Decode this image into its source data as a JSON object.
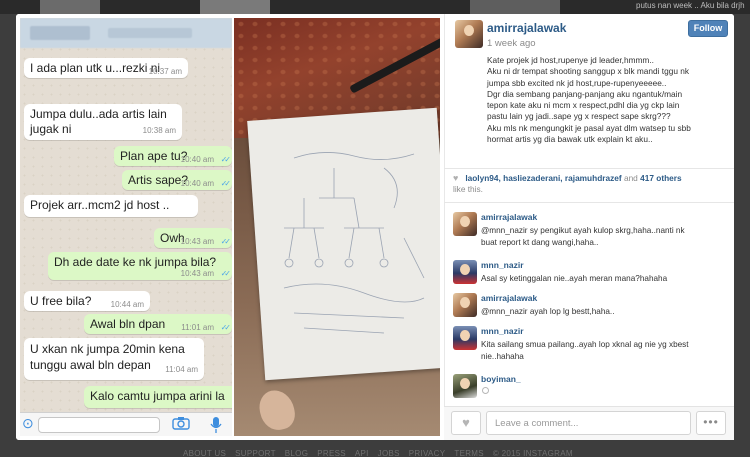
{
  "backdrop": {
    "top_text": "putus nan week .. Aku bila drjh"
  },
  "footer": {
    "links": [
      "ABOUT US",
      "SUPPORT",
      "BLOG",
      "PRESS",
      "API",
      "JOBS",
      "PRIVACY",
      "TERMS"
    ],
    "copyright": "© 2015 INSTAGRAM"
  },
  "post": {
    "owner": "amirrajalawak",
    "time": "1 week ago",
    "follow_label": "Follow",
    "caption_lines": [
      "Kate projek jd host,rupenye jd leader,hmmm..",
      "Aku ni dr tempat shooting sanggup x blk mandi tggu nk",
      "jumpa sbb excited nk jd host,rupe-rupenyeeeee..",
      "Dgr dia sembang panjang-panjang aku ngantuk/main",
      "tepon kate aku ni mcm x respect,pdhl dia yg ckp lain",
      "pastu lain yg jadi..sape yg x respect sape skrg???",
      "Aku mls nk mengungkit je pasal ayat dlm watsep tu sbb",
      "hormat artis yg dia bawak utk explain kt aku.."
    ],
    "likes": {
      "users": "laolyn94, hasliezaderani, rajamuhdrazef",
      "and": "and",
      "count": "417 others",
      "suffix": "like this."
    }
  },
  "comments": [
    {
      "user": "amirrajalawak",
      "lines": [
        "@mnn_nazir sy pengikut ayah kulop skrg,haha..nanti nk",
        "buat report kt dang wangi,haha.."
      ]
    },
    {
      "user": "mnn_nazir",
      "lines": [
        "Asal sy ketinggalan nie..ayah meran mana?hahaha"
      ]
    },
    {
      "user": "amirrajalawak",
      "lines": [
        "@mnn_nazir ayah lop lg bestt,haha.."
      ]
    },
    {
      "user": "mnn_nazir",
      "lines": [
        "Kita sailang smua pailang..ayah lop xknal ag nie yg xbest",
        "nie..hahaha"
      ]
    },
    {
      "user": "boyiman_",
      "lines": []
    }
  ],
  "comment_box": {
    "placeholder": "Leave a comment...",
    "more_label": "•••"
  },
  "chat": {
    "messages": [
      {
        "text": "I ada plan utk u...rezki ni",
        "time": "10:37 am",
        "dir": "in"
      },
      {
        "text": "Jumpa dulu..ada artis lain",
        "text2": "jugak ni",
        "time": "10:38 am",
        "dir": "in"
      },
      {
        "text": "Plan ape tu?",
        "time": "10:40 am",
        "dir": "out"
      },
      {
        "text": "Artis sape?",
        "time": "10:40 am",
        "dir": "out"
      },
      {
        "text": "Projek arr..mcm2 jd host ..",
        "time": "",
        "dir": "in"
      },
      {
        "text": "Owh",
        "time": "10:43 am",
        "dir": "out"
      },
      {
        "text": "Dh ade date ke nk jumpa bila?",
        "time": "10:43 am",
        "dir": "out"
      },
      {
        "text": "U free bila?",
        "time": "10:44 am",
        "dir": "in"
      },
      {
        "text": "Awal bln dpan",
        "time": "11:01 am",
        "dir": "out"
      },
      {
        "text": "U xkan nk jumpa 20min kena",
        "text2": "tunggu awal bln depan",
        "time": "11:04 am",
        "dir": "in"
      },
      {
        "text": "Kalo camtu jumpa arini la",
        "time": "",
        "dir": "out"
      }
    ]
  }
}
